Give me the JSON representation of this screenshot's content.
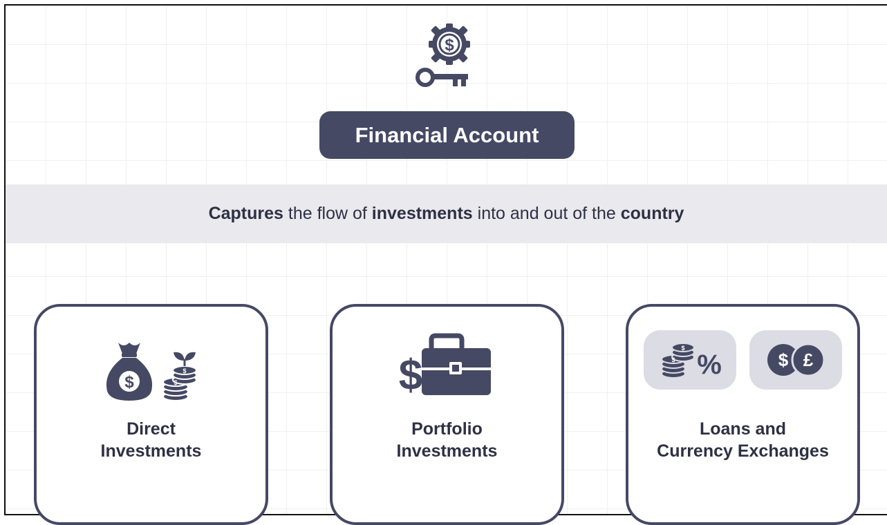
{
  "header": {
    "title": "Financial Account",
    "icon": "gear-dollar-key-icon"
  },
  "band": {
    "w1": "Captures",
    "t1": " the flow of ",
    "w2": "investments",
    "t2": " into and out of the ",
    "w3": "country"
  },
  "cards": [
    {
      "line1": "Direct",
      "line2": "Investments",
      "icon": "money-bag-coins-icon"
    },
    {
      "line1": "Portfolio",
      "line2": "Investments",
      "icon": "dollar-briefcase-icon"
    },
    {
      "line1": "Loans and",
      "line2": "Currency Exchanges",
      "icons": [
        "coins-percent-icon",
        "dollar-pound-icon"
      ]
    }
  ],
  "symbols": {
    "dollar": "$",
    "percent": "%",
    "pound": "£"
  },
  "colors": {
    "primary": "#464964",
    "band": "#e9e9ee",
    "chip": "#dcdce4"
  }
}
